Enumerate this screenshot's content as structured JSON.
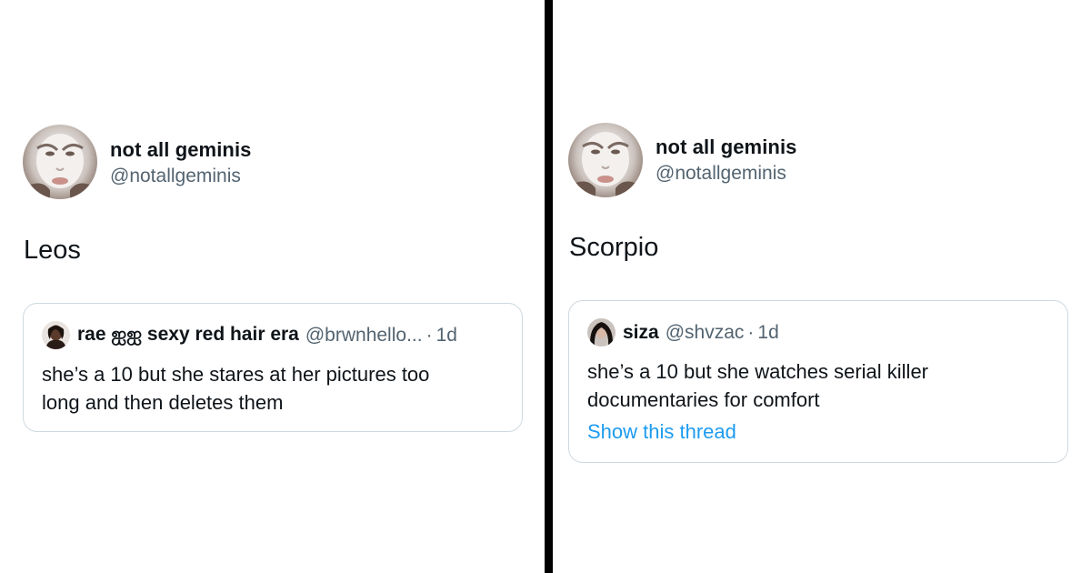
{
  "left": {
    "author": {
      "display_name": "not all geminis",
      "handle": "@notallgeminis"
    },
    "tweet_text": "Leos",
    "quote": {
      "display_name": "rae ஐஐ sexy red hair era",
      "handle": "@brwnhello...",
      "separator": "·",
      "time": "1d",
      "text_line1": "she’s a 10 but she stares at her pictures too",
      "text_line2": "long and then deletes them"
    }
  },
  "right": {
    "author": {
      "display_name": "not all geminis",
      "handle": "@notallgeminis"
    },
    "tweet_text": "Scorpio",
    "quote": {
      "display_name": "siza",
      "handle": "@shvzac",
      "separator": "·",
      "time": "1d",
      "text_line1": "she’s a 10 but she watches serial killer",
      "text_line2": "documentaries for comfort",
      "show_thread": "Show this thread"
    }
  },
  "colors": {
    "text_primary": "#0f1419",
    "text_secondary": "#536471",
    "link": "#1d9bf0",
    "border": "#cfd9de",
    "divider": "#000000"
  }
}
